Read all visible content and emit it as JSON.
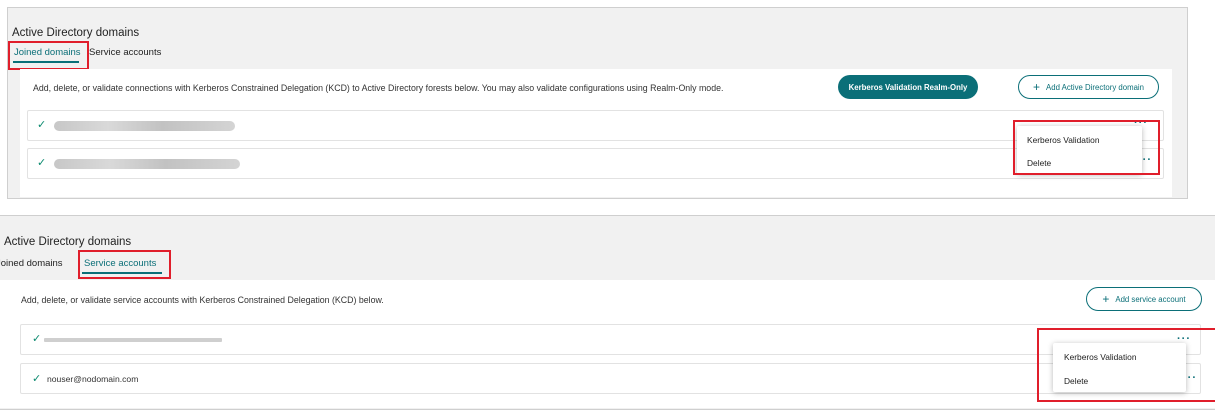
{
  "panel1": {
    "title": "Active Directory domains",
    "tabs": [
      {
        "label": "Joined domains",
        "active": true
      },
      {
        "label": "Service accounts",
        "active": false
      }
    ],
    "description": "Add, delete, or validate connections with Kerberos Constrained Delegation (KCD) to Active Directory forests below. You may also validate configurations using Realm-Only mode.",
    "realm_button_label": "Kerberos Validation Realm-Only",
    "add_button_label": "Add Active Directory domain",
    "dots": "···",
    "menu": [
      {
        "label": "Kerberos Validation"
      },
      {
        "label": "Delete"
      }
    ]
  },
  "panel2": {
    "title": "Active Directory domains",
    "tabs": [
      {
        "label": "Joined domains",
        "active": false
      },
      {
        "label": "Service accounts",
        "active": true
      }
    ],
    "description": "Add, delete, or validate service accounts with Kerberos Constrained Delegation (KCD) below.",
    "add_button_label": "Add service account",
    "row2_text": "nouser@nodomain.com",
    "dots": "···",
    "menu": [
      {
        "label": "Kerberos Validation"
      },
      {
        "label": "Delete"
      }
    ]
  },
  "colors": {
    "accent": "#0b6f78",
    "highlight_box": "#e01e2b",
    "check": "#0b8a6f"
  },
  "icons": {
    "check": "✓",
    "plus": "+"
  }
}
